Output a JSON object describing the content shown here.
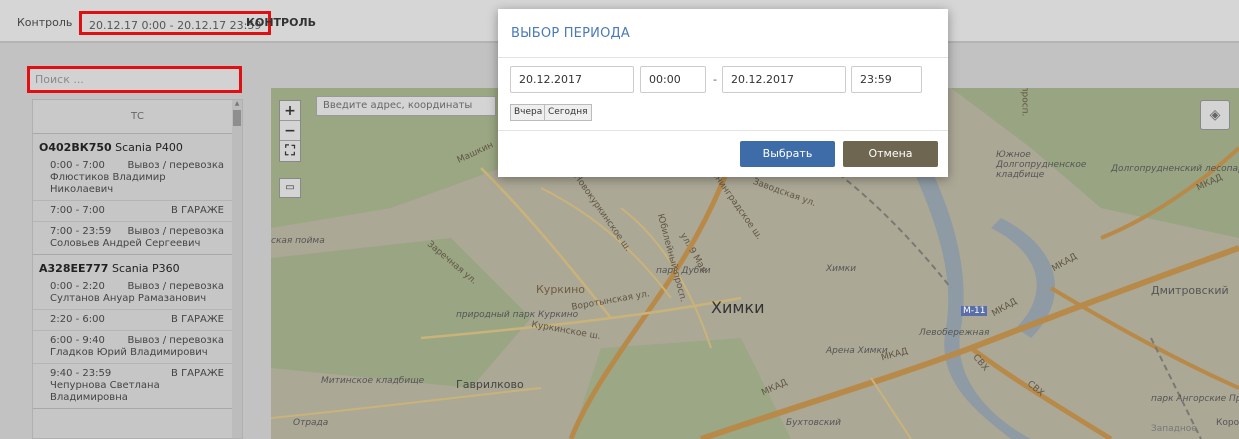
{
  "topbar": {
    "root": "Контроль",
    "range": "20.12.17 0:00 - 20.12.17 23:59",
    "title": "КОНТРОЛЬ"
  },
  "search": {
    "placeholder": "Поиск ..."
  },
  "list": {
    "header": "ТС",
    "vehicles": [
      {
        "plate": "О402ВК750",
        "model": "Scania P400",
        "trips": [
          {
            "time": "0:00 - 7:00",
            "type": "Вывоз / перевозка",
            "driver": "Флюстиков Владимир Николаевич"
          },
          {
            "time": "7:00 - 7:00",
            "type": "В ГАРАЖЕ",
            "driver": ""
          },
          {
            "time": "7:00 - 23:59",
            "type": "Вывоз / перевозка",
            "driver": "Соловьев Андрей Сергеевич"
          }
        ]
      },
      {
        "plate": "А328ЕЕ777",
        "model": "Scania P360",
        "trips": [
          {
            "time": "0:00 - 2:20",
            "type": "Вывоз / перевозка",
            "driver": "Султанов Ануар Рамазанович"
          },
          {
            "time": "2:20 - 6:00",
            "type": "В ГАРАЖЕ",
            "driver": ""
          },
          {
            "time": "6:00 - 9:40",
            "type": "Вывоз / перевозка",
            "driver": "Гладков Юрий Владимирович"
          },
          {
            "time": "9:40 - 23:59",
            "type": "В ГАРАЖЕ",
            "driver": "Чепурнова Светлана Владимировна"
          }
        ]
      }
    ]
  },
  "map": {
    "address_placeholder": "Введите адрес, координаты",
    "zoom_in": "+",
    "zoom_out": "−",
    "labels": {
      "khimki": "Химки",
      "kurkino": "Куркино",
      "gavrilkovo": "Гаврилково",
      "dmitrovsky": "Дмитровский",
      "mkad1": "МКАД",
      "mkad2": "МКАД",
      "mkad3": "МКАД",
      "mkad4": "МКАД",
      "mkad5": "МКАД",
      "park_dubki": "парк Дубки",
      "prirodny_park": "природный парк Куркино",
      "mitinskoe": "Митинское кладбище",
      "yuzhnoe": "Южное Долгопрудненское кладбище",
      "dolgoprud_forest": "Долгопрудненский лесопарк",
      "arena": "Арена Химки",
      "levoberezh": "Левобережная",
      "khimki_st": "Химки",
      "vorobinskaya": "Воротынская ул.",
      "kurkinskoe": "Куркинское ш.",
      "novokurkinskoe": "Новокуркинское ш.",
      "leningradskoe": "Ленинградское ш.",
      "yubileyny": "Юбилейный просп.",
      "ul9maya": "ул. 9 Мая",
      "zarechnaya": "Заречная ул.",
      "mashkin": "Машкин",
      "zavodskaya": "Заводская ул.",
      "skhodnenskaya": "ская пойма",
      "otrada": "Отрада",
      "anggorskie": "парк Ангорские Пруды",
      "svh1": "СВХ",
      "svh2": "СВХ",
      "m11": "М-11",
      "prosp": "просп.",
      "zapadnoe": "Западное",
      "kopy": "Коро",
      "bukhta": "Бухтовский"
    }
  },
  "modal": {
    "title": "ВЫБОР ПЕРИОДА",
    "date_from": "20.12.2017",
    "time_from": "00:00",
    "dash": "-",
    "date_to": "20.12.2017",
    "time_to": "23:59",
    "yesterday": "Вчера",
    "today": "Сегодня",
    "select": "Выбрать",
    "cancel": "Отмена"
  },
  "colors": {
    "highlight": "#e01010",
    "select_button": "#3d6ca8",
    "cancel_button": "#6e6650",
    "modal_title": "#4a7ab8"
  }
}
